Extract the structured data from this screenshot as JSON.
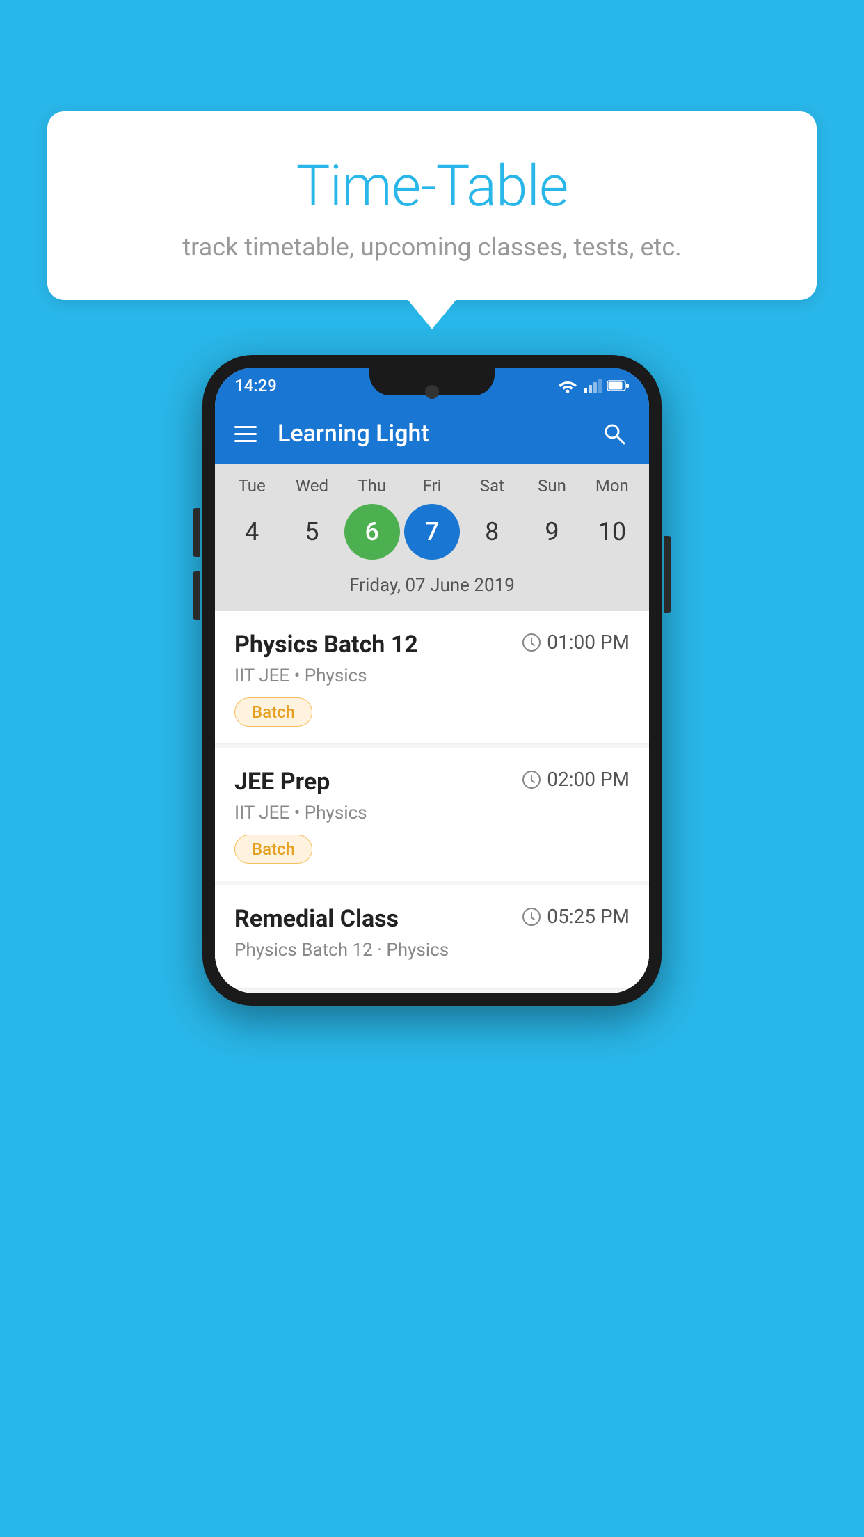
{
  "background_color": "#29b6e8",
  "bubble": {
    "title": "Time-Table",
    "subtitle": "track timetable, upcoming classes, tests, etc."
  },
  "phone": {
    "status_bar": {
      "time": "14:29"
    },
    "app_bar": {
      "title": "Learning Light"
    },
    "calendar": {
      "days": [
        {
          "label": "Tue",
          "num": "4"
        },
        {
          "label": "Wed",
          "num": "5"
        },
        {
          "label": "Thu",
          "num": "6",
          "state": "today"
        },
        {
          "label": "Fri",
          "num": "7",
          "state": "selected"
        },
        {
          "label": "Sat",
          "num": "8"
        },
        {
          "label": "Sun",
          "num": "9"
        },
        {
          "label": "Mon",
          "num": "10"
        }
      ],
      "selected_date_label": "Friday, 07 June 2019"
    },
    "classes": [
      {
        "name": "Physics Batch 12",
        "time": "01:00 PM",
        "meta": "IIT JEE • Physics",
        "tag": "Batch"
      },
      {
        "name": "JEE Prep",
        "time": "02:00 PM",
        "meta": "IIT JEE • Physics",
        "tag": "Batch"
      },
      {
        "name": "Remedial Class",
        "time": "05:25 PM",
        "meta": "Physics Batch 12 · Physics",
        "tag": ""
      }
    ]
  }
}
